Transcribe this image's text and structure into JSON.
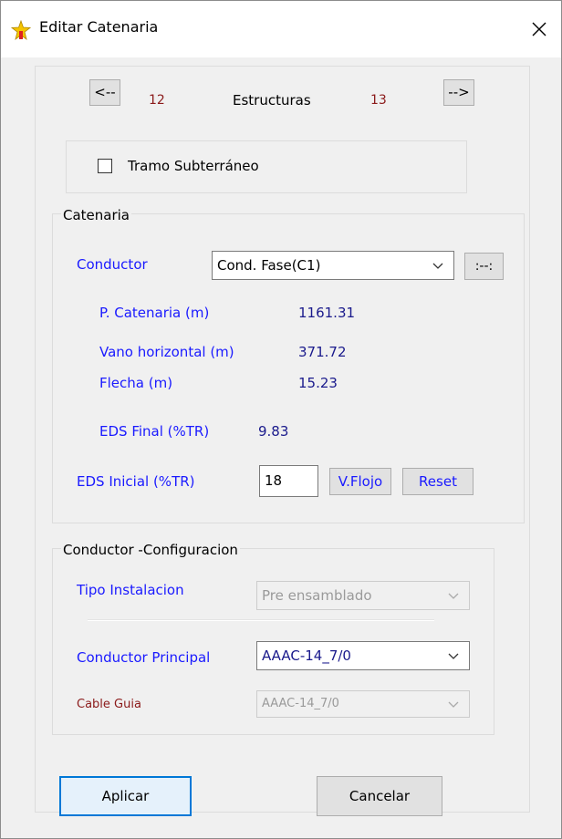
{
  "window": {
    "title": "Editar Catenaria",
    "close_symbol": "✕"
  },
  "nav": {
    "prev_label": "<--",
    "next_label": "-->",
    "prev_number": "12",
    "next_number": "13",
    "center_label": "Estructuras"
  },
  "tramo": {
    "label": "Tramo Subterráneo",
    "checked": false
  },
  "catenaria": {
    "legend": "Catenaria",
    "conductor_label": "Conductor",
    "conductor_value": "Cond. Fase(C1)",
    "dots_button": ":--:",
    "p_catenaria_label": "P. Catenaria (m)",
    "p_catenaria_value": "1161.31",
    "vano_label": "Vano horizontal (m)",
    "vano_value": "371.72",
    "flecha_label": "Flecha (m)",
    "flecha_value": "15.23",
    "eds_final_label": "EDS Final (%TR)",
    "eds_final_value": "9.83",
    "eds_inicial_label": "EDS Inicial (%TR)",
    "eds_inicial_value": "18",
    "vflojo_button": "V.Flojo",
    "reset_button": "Reset"
  },
  "config": {
    "legend": "Conductor -Configuracion",
    "tipo_label": "Tipo Instalacion",
    "tipo_value": "Pre ensamblado",
    "principal_label": "Conductor Principal",
    "principal_value": "AAAC-14_7/0",
    "guia_label": "Cable Guia",
    "guia_value": "AAAC-14_7/0"
  },
  "footer": {
    "apply_button": "Aplicar",
    "cancel_button": "Cancelar"
  },
  "colors": {
    "label_blue": "#1a1aff",
    "label_navy": "#1a1a8c",
    "number_red": "#8b1a1a",
    "accent_border": "#0078d7"
  }
}
